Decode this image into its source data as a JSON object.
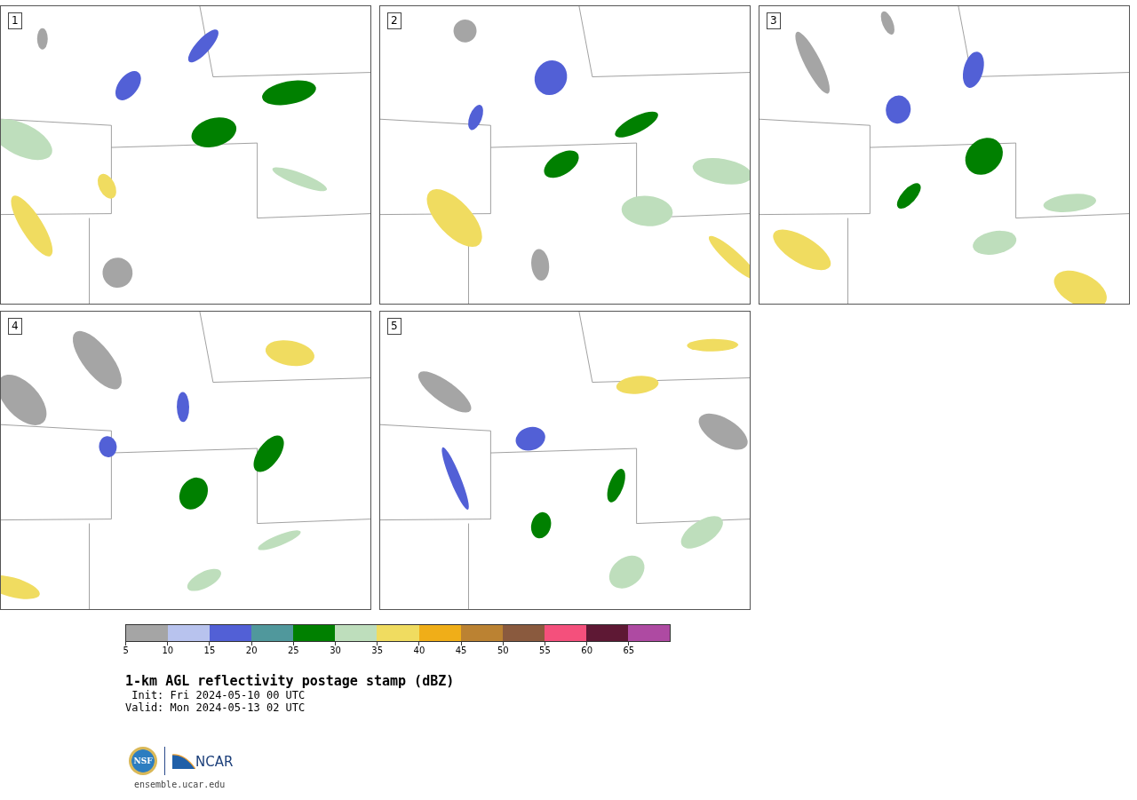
{
  "panels": [
    {
      "label": "1"
    },
    {
      "label": "2"
    },
    {
      "label": "3"
    },
    {
      "label": "4"
    },
    {
      "label": "5"
    }
  ],
  "colorbar": {
    "segments": [
      {
        "color": "#a5a5a5"
      },
      {
        "color": "#b8c3ee"
      },
      {
        "color": "#5260d6"
      },
      {
        "color": "#50989c"
      },
      {
        "color": "#008000"
      },
      {
        "color": "#bedebc"
      },
      {
        "color": "#f0dc60"
      },
      {
        "color": "#f0ae18"
      },
      {
        "color": "#bb8232"
      },
      {
        "color": "#8a5a3e"
      },
      {
        "color": "#f4507c"
      },
      {
        "color": "#5e1834"
      },
      {
        "color": "#ae4aa2"
      }
    ],
    "ticks": [
      "5",
      "10",
      "15",
      "20",
      "25",
      "30",
      "35",
      "40",
      "45",
      "50",
      "55",
      "60",
      "65"
    ]
  },
  "title": "1-km AGL reflectivity postage stamp (dBZ)",
  "init": " Init: Fri 2024-05-10 00 UTC",
  "valid": "Valid: Mon 2024-05-13 02 UTC",
  "logo": {
    "seal": "NSF",
    "wordmark": "NCAR"
  },
  "site": "ensemble.ucar.edu"
}
